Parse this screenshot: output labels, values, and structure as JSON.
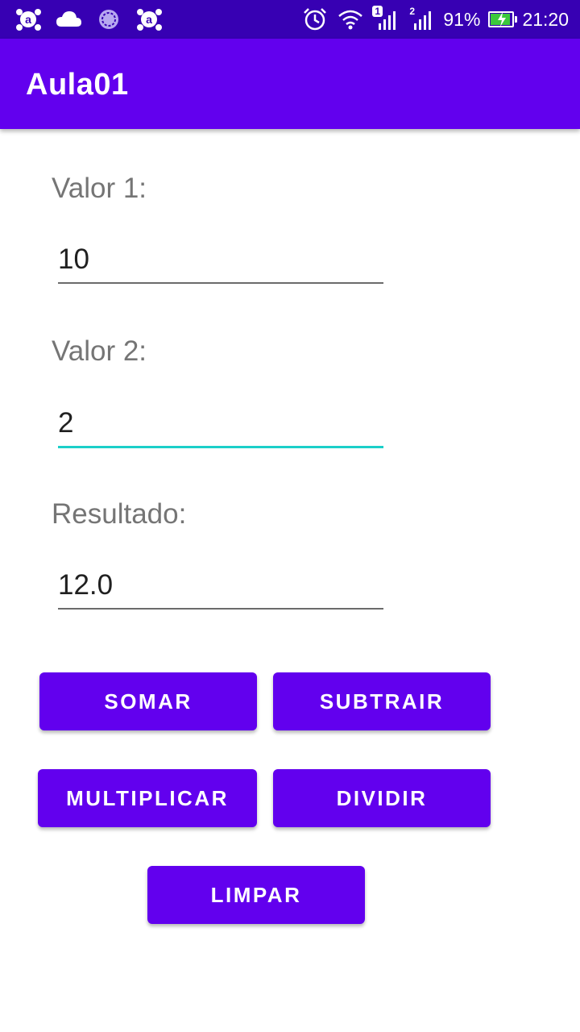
{
  "status_bar": {
    "left_icons": [
      "avast-icon",
      "cloud-icon",
      "sync-circle-icon",
      "avast-icon"
    ],
    "sim1_badge": "1",
    "sim2_badge": "2",
    "battery_percent": "91%",
    "battery_level": 0.91,
    "time": "21:20"
  },
  "app_bar": {
    "title": "Aula01"
  },
  "form": {
    "valor1_label": "Valor 1:",
    "valor1_value": "10",
    "valor2_label": "Valor 2:",
    "valor2_value": "2",
    "resultado_label": "Resultado:",
    "resultado_value": "12.0"
  },
  "buttons": {
    "somar": "SOMAR",
    "subtrair": "SUBTRAIR",
    "multiplicar": "MULTIPLICAR",
    "dividir": "DIVIDIR",
    "limpar": "LIMPAR"
  },
  "colors": {
    "status_bar": "#3700b3",
    "primary": "#6200ee",
    "accent_focus": "#1ccfc9",
    "label_gray": "#757575"
  }
}
